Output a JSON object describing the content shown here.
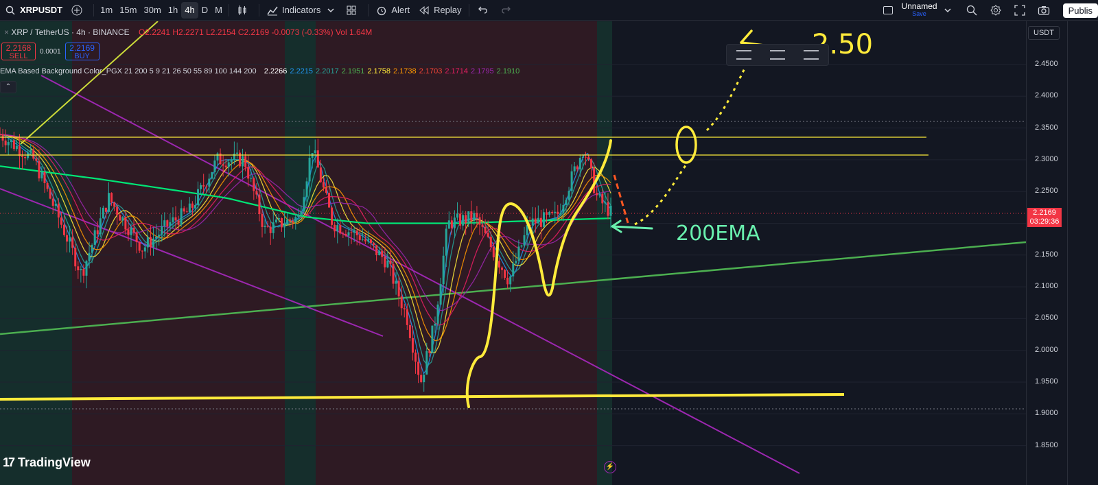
{
  "toolbar": {
    "symbol": "XRPUSDT",
    "timeframes": [
      "1m",
      "15m",
      "30m",
      "1h",
      "4h",
      "D",
      "M"
    ],
    "active_timeframe": "4h",
    "indicators_label": "Indicators",
    "alert_label": "Alert",
    "replay_label": "Replay",
    "layout_name": "Unnamed",
    "layout_status": "Save",
    "publish_label": "Publis"
  },
  "legend": {
    "title": "XRP / TetherUS · 4h · BINANCE",
    "open": "O2.2241",
    "high": "H2.2271",
    "low": "L2.2154",
    "close": "C2.2169",
    "change": "-0.0073 (-0.33%)",
    "volume": "Vol 1.64M"
  },
  "trade": {
    "sell_price": "2.2168",
    "sell_label": "SELL",
    "spread": "0.0001",
    "buy_price": "2.2169",
    "buy_label": "BUY"
  },
  "ema_legend": {
    "name": "EMA Based Background Color_PGX 21 200 5 9 21 26 50 55 89 100 144 200",
    "values": [
      {
        "v": "2.2266",
        "color": "#ffffff"
      },
      {
        "v": "2.2215",
        "color": "#2196f3"
      },
      {
        "v": "2.2017",
        "color": "#26a69a"
      },
      {
        "v": "2.1951",
        "color": "#4caf50"
      },
      {
        "v": "2.1758",
        "color": "#ffeb3b"
      },
      {
        "v": "2.1738",
        "color": "#ff9800"
      },
      {
        "v": "2.1703",
        "color": "#f44336"
      },
      {
        "v": "2.1714",
        "color": "#e91e63"
      },
      {
        "v": "2.1795",
        "color": "#9c27b0"
      },
      {
        "v": "2.1910",
        "color": "#4caf50"
      }
    ]
  },
  "axis": {
    "currency": "USDT",
    "ticks": [
      "2.4500",
      "2.4000",
      "2.3500",
      "2.3000",
      "2.2500",
      "2.2000",
      "2.1500",
      "2.1000",
      "2.0500",
      "2.0000",
      "1.9500",
      "1.9000",
      "1.8500"
    ],
    "last_price": "2.2169",
    "countdown": "03:29:36"
  },
  "annotations": {
    "target": "2.50",
    "ma_label": "200EMA"
  },
  "branding": {
    "logo": "TradingView"
  },
  "colors": {
    "background": "#131722",
    "bull": "#26a69a",
    "bear": "#f23645",
    "highlight": "#ffeb3b",
    "trendline_green": "#4caf50",
    "trendline_purple": "#9c27b0"
  },
  "chart_data": {
    "type": "candlestick",
    "title": "XRP / TetherUS · 4h · BINANCE",
    "ylim": [
      1.83,
      2.48
    ],
    "horizontal_levels": [
      2.335,
      2.308,
      1.93
    ],
    "ema200_approx": [
      {
        "x": 0,
        "y": 2.29
      },
      {
        "x": 0.16,
        "y": 2.27
      },
      {
        "x": 0.3,
        "y": 2.25
      },
      {
        "x": 0.37,
        "y": 2.24
      },
      {
        "x": 0.5,
        "y": 2.21
      },
      {
        "x": 0.6,
        "y": 2.2
      },
      {
        "x": 0.75,
        "y": 2.2
      },
      {
        "x": 1,
        "y": 2.208
      }
    ],
    "price_path": [
      {
        "x": 0,
        "y": 2.34
      },
      {
        "x": 0.05,
        "y": 2.3
      },
      {
        "x": 0.09,
        "y": 2.2
      },
      {
        "x": 0.12,
        "y": 2.12
      },
      {
        "x": 0.16,
        "y": 2.24
      },
      {
        "x": 0.21,
        "y": 2.16
      },
      {
        "x": 0.25,
        "y": 2.2
      },
      {
        "x": 0.28,
        "y": 2.22
      },
      {
        "x": 0.32,
        "y": 2.3
      },
      {
        "x": 0.36,
        "y": 2.3
      },
      {
        "x": 0.39,
        "y": 2.19
      },
      {
        "x": 0.44,
        "y": 2.21
      },
      {
        "x": 0.46,
        "y": 2.32
      },
      {
        "x": 0.49,
        "y": 2.2
      },
      {
        "x": 0.53,
        "y": 2.18
      },
      {
        "x": 0.57,
        "y": 2.14
      },
      {
        "x": 0.6,
        "y": 2.05
      },
      {
        "x": 0.62,
        "y": 1.95
      },
      {
        "x": 0.64,
        "y": 2.04
      },
      {
        "x": 0.66,
        "y": 2.2
      },
      {
        "x": 0.7,
        "y": 2.21
      },
      {
        "x": 0.73,
        "y": 2.15
      },
      {
        "x": 0.75,
        "y": 2.11
      },
      {
        "x": 0.78,
        "y": 2.2
      },
      {
        "x": 0.82,
        "y": 2.21
      },
      {
        "x": 0.86,
        "y": 2.32
      },
      {
        "x": 0.88,
        "y": 2.24
      },
      {
        "x": 0.9,
        "y": 2.217
      }
    ]
  }
}
